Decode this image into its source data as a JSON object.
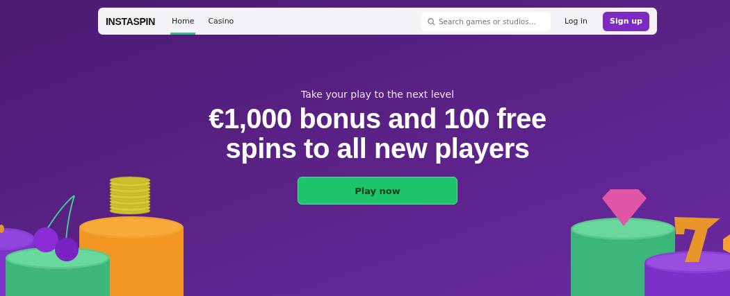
{
  "nav": {
    "logo": "INSTASPIN",
    "links": [
      {
        "label": "Home",
        "selected": true
      },
      {
        "label": "Casino",
        "selected": false
      }
    ],
    "search": {
      "placeholder": "Search games or studios..."
    },
    "login": "Log in",
    "signup": "Sign up"
  },
  "hero": {
    "subtitle": "Take your play to the next level",
    "headline": [
      "€1,000 bonus and 100 free",
      "spins to all new players"
    ],
    "cta": "Play now"
  }
}
